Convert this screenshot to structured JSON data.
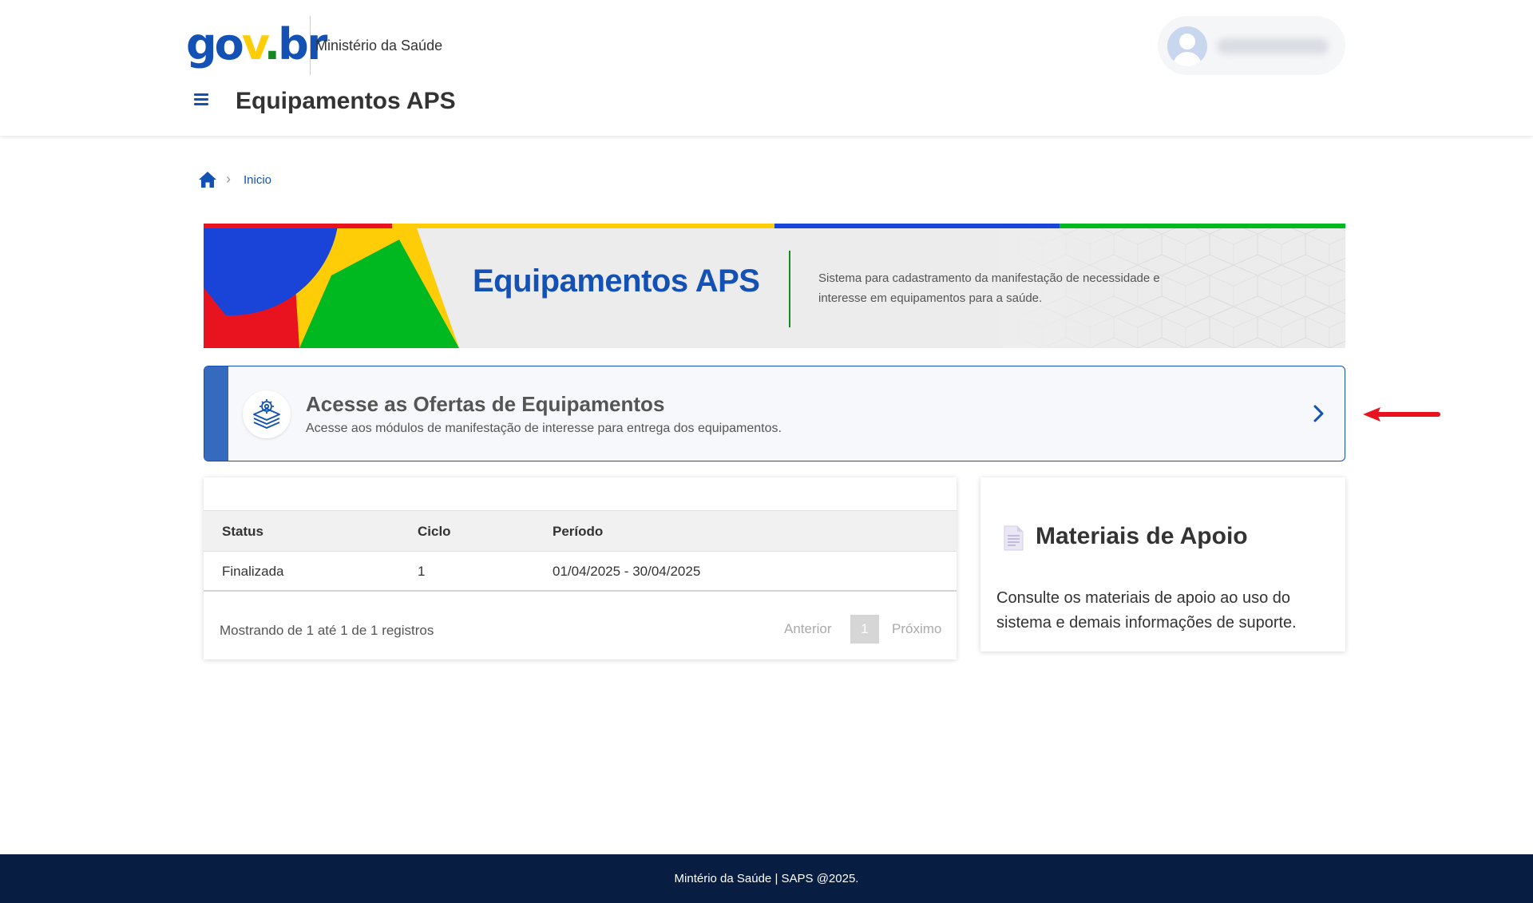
{
  "header": {
    "logo": {
      "part1": "go",
      "part2": "v",
      "part3": ".",
      "part4": "br"
    },
    "ministry": "Ministério da Saúde",
    "app_title": "Equipamentos APS"
  },
  "breadcrumb": {
    "home_icon": "home-icon",
    "current": "Inicio"
  },
  "banner": {
    "title": "Equipamentos APS",
    "description": "Sistema para cadastramento da manifestação de necessidade e interesse em equipamentos para a saúde."
  },
  "offers": {
    "title": "Acesse as Ofertas de Equipamentos",
    "subtitle": "Acesse aos módulos de manifestação de interesse para entrega dos equipamentos."
  },
  "table": {
    "columns": [
      "Status",
      "Ciclo",
      "Período"
    ],
    "rows": [
      [
        "Finalizada",
        "1",
        "01/04/2025 - 30/04/2025"
      ]
    ],
    "info": "Mostrando de 1 até 1 de 1 registros",
    "pagination": {
      "prev": "Anterior",
      "current": "1",
      "next": "Próximo"
    }
  },
  "materials": {
    "title": "Materiais de Apoio",
    "text": "Consulte os materiais de apoio ao uso do sistema e demais informações de suporte."
  },
  "footer": {
    "text": "Mintério da Saúde | SAPS @2025."
  },
  "colors": {
    "primary_blue": "#1351b4",
    "gov_yellow": "#ffcd07",
    "gov_green": "#168821",
    "footer_bg": "#071d41",
    "annotation_red": "#e8131f"
  }
}
